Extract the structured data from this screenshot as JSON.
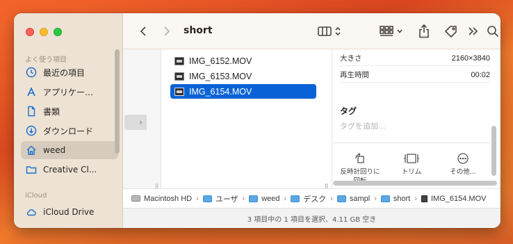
{
  "window": {
    "title": "short"
  },
  "sidebar": {
    "section_favorites": "よく使う項目",
    "section_icloud": "iCloud",
    "items": [
      {
        "label": "最近の項目",
        "icon": "clock-icon"
      },
      {
        "label": "アプリケー…",
        "icon": "apps-icon"
      },
      {
        "label": "書類",
        "icon": "document-icon"
      },
      {
        "label": "ダウンロード",
        "icon": "download-icon"
      },
      {
        "label": "weed",
        "icon": "home-icon",
        "selected": true
      },
      {
        "label": "Creative Cl...",
        "icon": "folder-icon"
      }
    ],
    "icloud_items": [
      {
        "label": "iCloud Drive",
        "icon": "cloud-icon"
      }
    ]
  },
  "files": [
    {
      "name": "IMG_6152.MOV"
    },
    {
      "name": "IMG_6153.MOV"
    },
    {
      "name": "IMG_6154.MOV",
      "selected": true
    }
  ],
  "info": {
    "rows": [
      {
        "label": "大きさ",
        "value": "2160×3840"
      },
      {
        "label": "再生時間",
        "value": "00:02"
      }
    ],
    "tags_title": "タグ",
    "tags_placeholder": "タグを追加...",
    "actions": [
      {
        "line1": "反時計回りに",
        "line2": "回転",
        "icon": "rotate-icon"
      },
      {
        "line1": "トリム",
        "line2": "",
        "icon": "trim-icon"
      },
      {
        "line1": "その他...",
        "line2": "",
        "icon": "more-icon"
      }
    ]
  },
  "pathbar": {
    "segments": [
      "Macintosh HD",
      "ユーザ",
      "weed",
      "デスク",
      "sampl",
      "short",
      "IMG_6154.MOV"
    ],
    "separator": "›"
  },
  "status": {
    "text": "3 項目中の 1 項目を選択、4.11 GB 空き"
  },
  "colors": {
    "selection": "#0a63d6",
    "sidebar_bg": "#ede2d4"
  }
}
